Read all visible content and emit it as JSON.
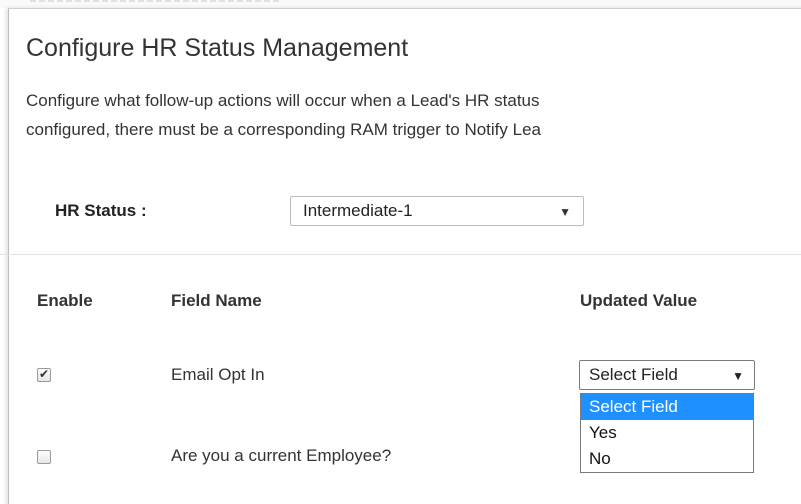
{
  "dialog": {
    "title": "Configure HR Status Management",
    "description_line1": "Configure what follow-up actions will occur when a Lead's HR status",
    "description_line2": "configured, there must be a corresponding RAM trigger to Notify Lea"
  },
  "hr_status": {
    "label": "HR Status :",
    "selected": "Intermediate-1",
    "caret": "▼"
  },
  "table": {
    "headers": {
      "enable": "Enable",
      "field_name": "Field Name",
      "updated_value": "Updated Value"
    },
    "rows": [
      {
        "field_name": "Email Opt In",
        "enabled": true,
        "check_glyph": "✔"
      },
      {
        "field_name": "Are you a current Employee?",
        "enabled": false
      }
    ]
  },
  "updated_value_select": {
    "selected": "Select Field",
    "caret": "▼",
    "options": [
      {
        "label": "Select Field",
        "highlighted": true
      },
      {
        "label": "Yes",
        "highlighted": false
      },
      {
        "label": "No",
        "highlighted": false
      }
    ]
  },
  "colors": {
    "highlight": "#1e90ff",
    "text": "#333333",
    "border": "#7a7a7a"
  }
}
